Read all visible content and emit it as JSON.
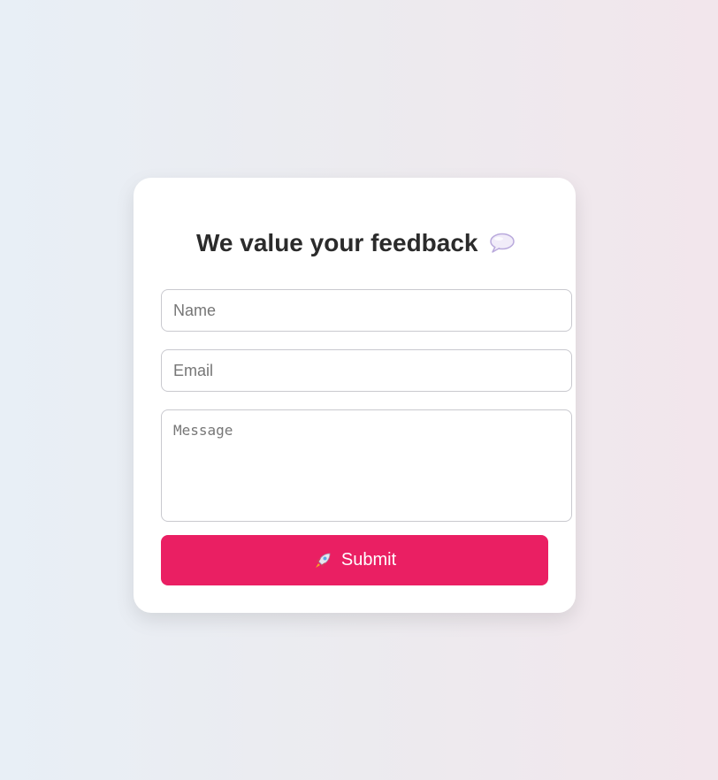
{
  "form": {
    "title": "We value your feedback",
    "title_icon": "speech-bubble-icon",
    "fields": {
      "name_placeholder": "Name",
      "email_placeholder": "Email",
      "message_placeholder": "Message"
    },
    "submit": {
      "label": "Submit",
      "icon": "rocket-icon"
    }
  },
  "colors": {
    "accent": "#ea1f63",
    "title": "#2b2b2b",
    "card": "#ffffff",
    "border": "#c9c9cf"
  }
}
